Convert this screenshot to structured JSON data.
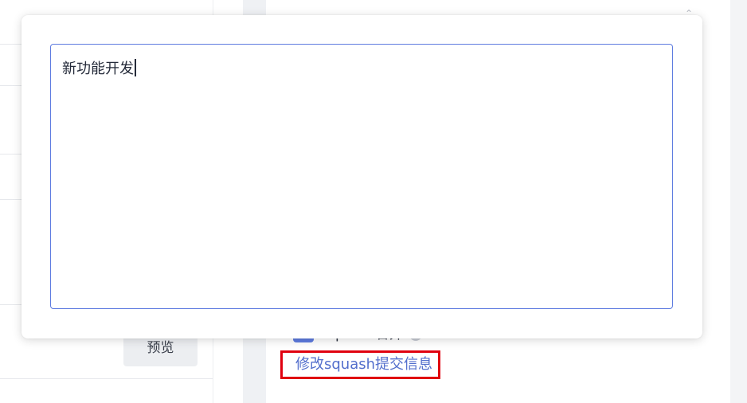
{
  "sidebar": {
    "preview_button_label": "预览"
  },
  "squash": {
    "checkbox_checked": true,
    "label": "squash 合并",
    "edit_link_label": "修改squash提交信息"
  },
  "dialog": {
    "commit_message_value": "新功能开发"
  },
  "colors": {
    "accent": "#5e7ce0",
    "link": "#526ecc",
    "highlight_box": "#e0000f"
  }
}
